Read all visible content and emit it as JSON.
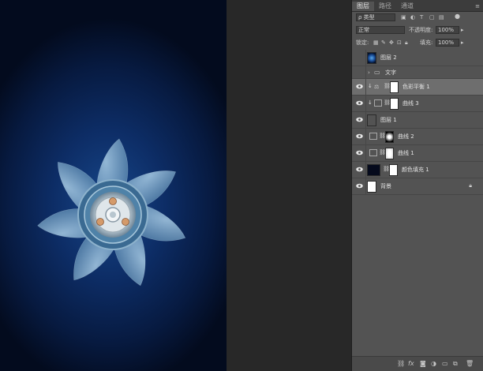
{
  "panel_tabs": [
    "图层",
    "路径",
    "通道"
  ],
  "filter": {
    "label": "ρ 类型"
  },
  "blend_mode": "正常",
  "opacity": {
    "label": "不透明度:",
    "value": "100%"
  },
  "lock": {
    "label": "锁定:"
  },
  "fill": {
    "label": "填充:",
    "value": "100%"
  },
  "layers": [
    {
      "name": "图层 2",
      "kind": "pixel",
      "visible": false,
      "selected": false
    },
    {
      "name": "文字",
      "kind": "group",
      "visible": false,
      "selected": false
    },
    {
      "name": "色彩平衡 1",
      "kind": "adjustment-color-balance",
      "visible": true,
      "selected": true,
      "clipped": true
    },
    {
      "name": "曲线 3",
      "kind": "adjustment-curves",
      "visible": true,
      "selected": false,
      "clipped": true
    },
    {
      "name": "图层 1",
      "kind": "pixel",
      "visible": true,
      "selected": false
    },
    {
      "name": "曲线 2",
      "kind": "adjustment-curves",
      "visible": true,
      "selected": false
    },
    {
      "name": "曲线 1",
      "kind": "adjustment-curves",
      "visible": true,
      "selected": false
    },
    {
      "name": "颜色填充 1",
      "kind": "fill",
      "visible": true,
      "selected": false
    },
    {
      "name": "背景",
      "kind": "background",
      "visible": true,
      "selected": false,
      "locked": true
    }
  ],
  "bottom_icons": [
    "link-icon",
    "fx-icon",
    "mask-icon",
    "adjustment-icon",
    "group-icon",
    "new-layer-icon",
    "delete-icon"
  ],
  "colors": {
    "panel_bg": "#535353",
    "selected_row": "#6e6e6e",
    "canvas_center": "#17478a",
    "canvas_edge": "#030b1e",
    "blade": "#8fb7d4"
  }
}
